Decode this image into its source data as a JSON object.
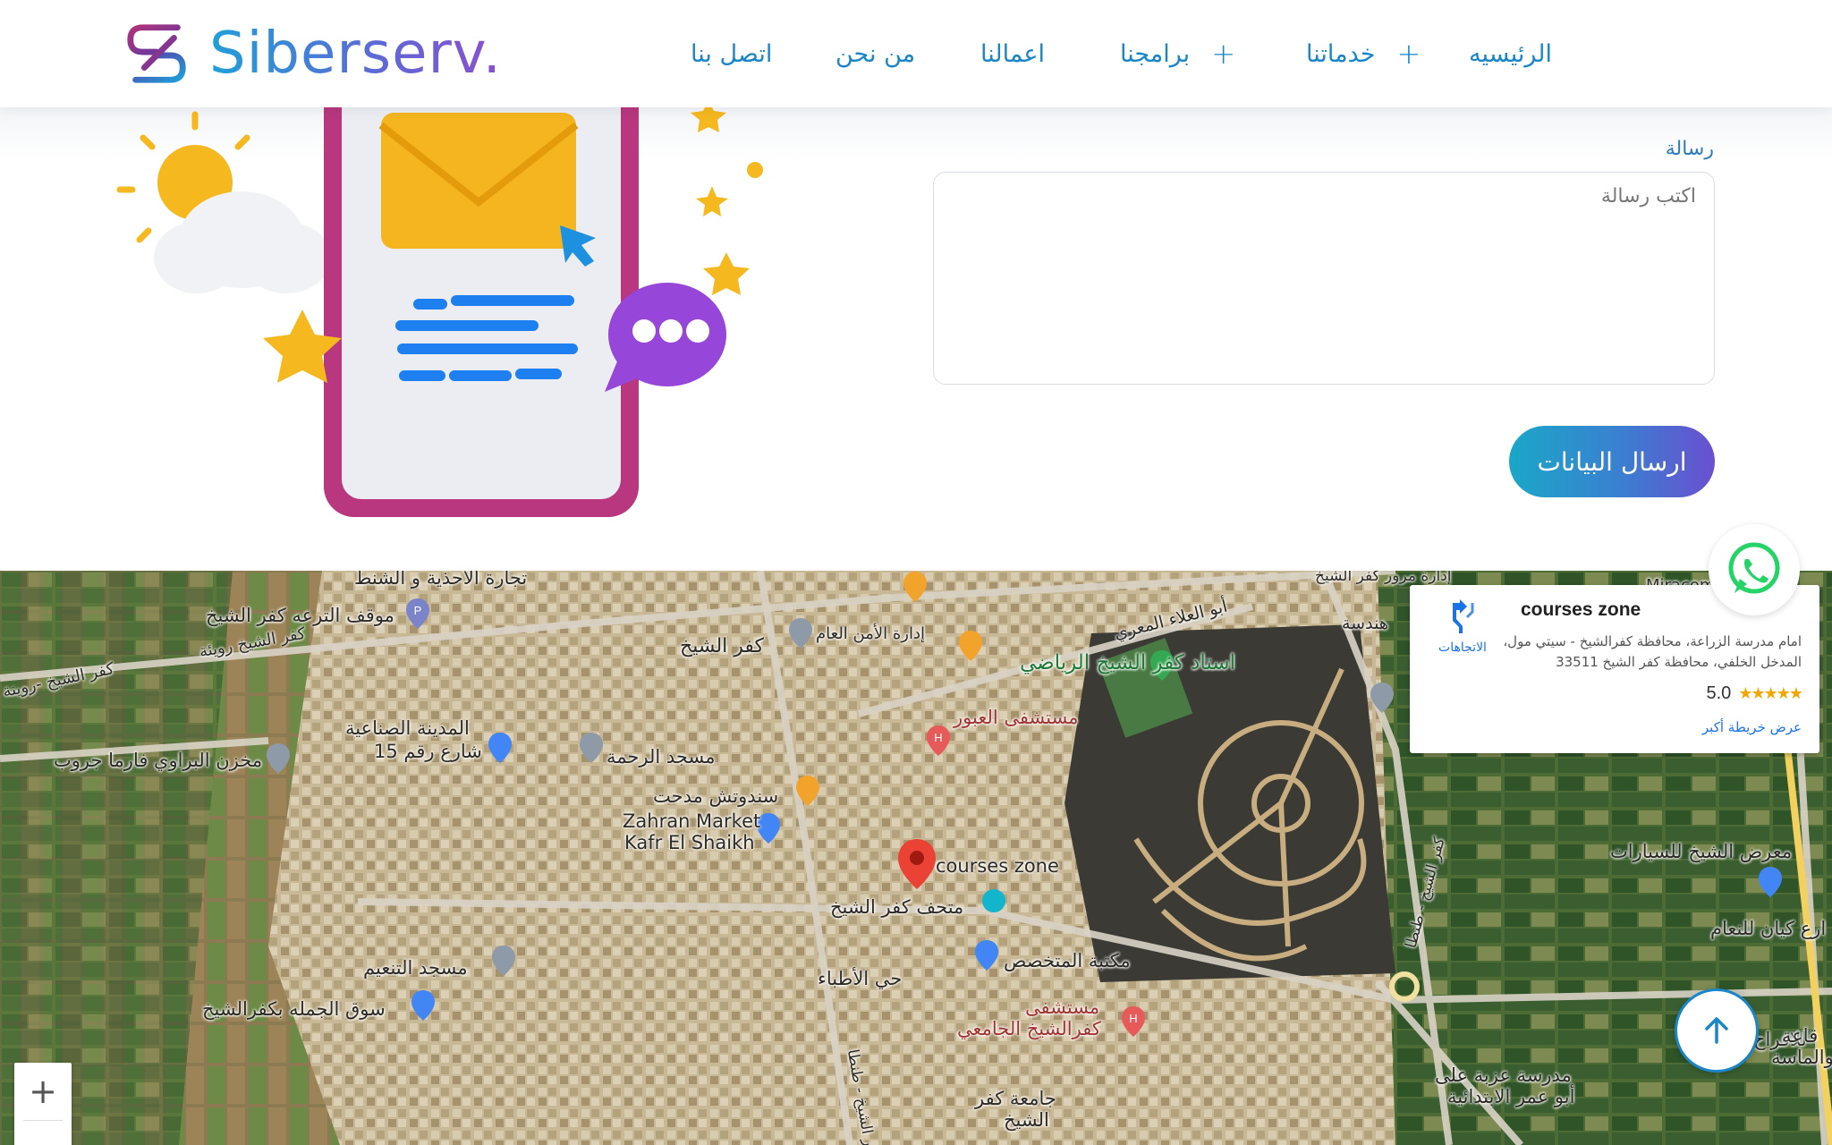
{
  "brand": {
    "name": "Siberserv.",
    "accent": "#1a86c8",
    "gradient_start": "#1ea0d8",
    "gradient_end": "#8b4fd0"
  },
  "nav": {
    "home": "الرئيسيه",
    "services": "خدماتنا",
    "programs": "برامجنا",
    "works": "اعمالنا",
    "about": "من نحن",
    "contact": "اتصل بنا",
    "expand_icon": "plus-icon"
  },
  "form": {
    "message_label": "رسالة",
    "message_placeholder": "اكتب رسالة",
    "submit_label": "ارسال البيانات"
  },
  "map": {
    "card": {
      "title": "courses zone",
      "address": "امام مدرسة الزراعة، محافظة كفرالشيخ - سيتي مول، المدخل الخلفي، محافظة كفر الشيخ 33511",
      "rating": "5.0",
      "stars": "★★★★★",
      "larger_map_link": "عرض خريطة أكبر",
      "directions_label": "الاتجاهات"
    },
    "zoom_in": "+",
    "labels": {
      "tijara": "تجارة الأحذية و الشنط",
      "mawqaf": "موقف الترعه كفر الشيخ",
      "kafr_rowina": "كفر الشيخ رويئة",
      "kafr_rowina2": "كفر الشيخ -روينة",
      "kafr_sheikh": "كفر الشيخ",
      "idara_amn": "إدارة الأمن العام",
      "abu_alaa": "أبو العلاء المعري",
      "stadium": "استاد كفر الشيخ الرياضي",
      "hospital_obour": "مستشفى العبور",
      "industrial": "المدينة الصناعية",
      "street15": "شارع رقم 15",
      "rahma": "مسجد الرحمة",
      "makhzan": "مخزن البراوي فارما جروب",
      "sandwich": "سندوتش مدحت",
      "zahran1": "Zahran Market",
      "zahran2": "Kafr El Shaikh",
      "courses_zone": "courses zone",
      "museum": "متحف كفر الشيخ",
      "tanaeem": "مسجد التنعيم",
      "atibba": "حي الأطباء",
      "maktaba": "مكتبة المتخصص",
      "souq": "سوق الجمله بكفرالشيخ",
      "hospital_univ1": "مستشفى",
      "hospital_univ2": "كفرالشيخ الجامعي",
      "jamaa1": "جامعة كفر",
      "jamaa2": "الشيخ",
      "maarad": "معرض الشيخ للسيارات",
      "kayan": "ارع كيان للنعام",
      "afrah": "للافراح",
      "qaaa": "قاعة",
      "walmassa": "والماسة",
      "madrasa1": "مدرسة عزبة على",
      "madrasa2": "أبو عمر الابتدائية",
      "handasa": "هندسة",
      "tanta_road": "كفر الشيخ - طنطا",
      "tanta_road2": "كفر الشيخ - طنطا",
      "top_right": "إدارة مرور كفر الشيخ",
      "miracomo": "Miracomo"
    }
  },
  "floating": {
    "whatsapp_icon": "whatsapp-icon",
    "scroll_top_icon": "arrow-up-icon"
  }
}
